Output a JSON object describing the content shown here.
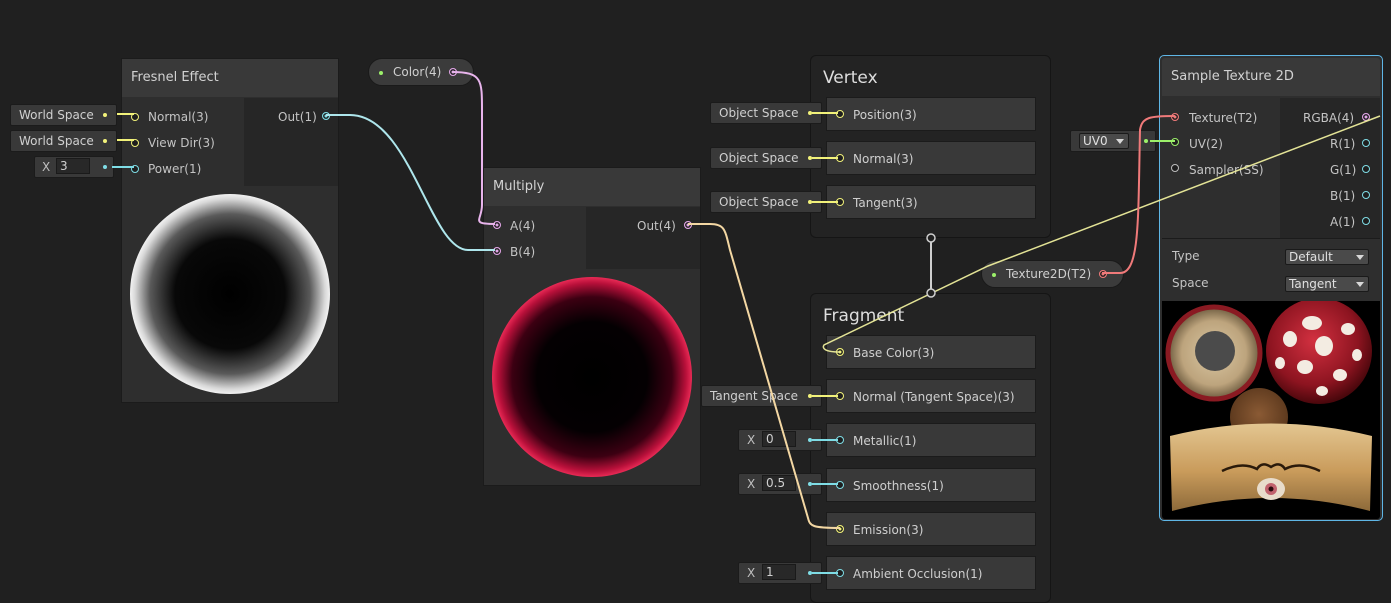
{
  "fresnel": {
    "title": "Fresnel Effect",
    "inputs": [
      "Normal(3)",
      "View Dir(3)",
      "Power(1)"
    ],
    "output": "Out(1)",
    "normal_space": "World Space",
    "viewdir_space": "World Space",
    "power_axis": "X",
    "power_value": "3"
  },
  "color_property": {
    "label": "Color(4)"
  },
  "multiply": {
    "title": "Multiply",
    "inputs": [
      "A(4)",
      "B(4)"
    ],
    "output": "Out(4)"
  },
  "vertex": {
    "title": "Vertex",
    "blocks": [
      "Position(3)",
      "Normal(3)",
      "Tangent(3)"
    ],
    "spaces": [
      "Object Space",
      "Object Space",
      "Object Space"
    ]
  },
  "fragment": {
    "title": "Fragment",
    "blocks": [
      "Base Color(3)",
      "Normal (Tangent Space)(3)",
      "Metallic(1)",
      "Smoothness(1)",
      "Emission(3)",
      "Ambient Occlusion(1)"
    ],
    "normal_space": "Tangent Space",
    "axis_label": "X",
    "metallic_value": "0",
    "smoothness_value": "0.5",
    "occlusion_value": "1"
  },
  "texture_property": {
    "label": "Texture2D(T2)"
  },
  "sample_texture": {
    "title": "Sample Texture 2D",
    "inputs": [
      "Texture(T2)",
      "UV(2)",
      "Sampler(SS)"
    ],
    "outputs": [
      "RGBA(4)",
      "R(1)",
      "G(1)",
      "B(1)",
      "A(1)"
    ],
    "uv_channel": "UV0",
    "type_label": "Type",
    "type_value": "Default",
    "space_label": "Space",
    "space_value": "Tangent"
  },
  "colors": {
    "background": "#202020",
    "vector3_port": "#f2f27a",
    "vector1_port": "#7fdde6",
    "vector4_port": "#e3a6e8",
    "texture_port": "#f07a7a",
    "selection_outline": "#5fb6e6"
  }
}
